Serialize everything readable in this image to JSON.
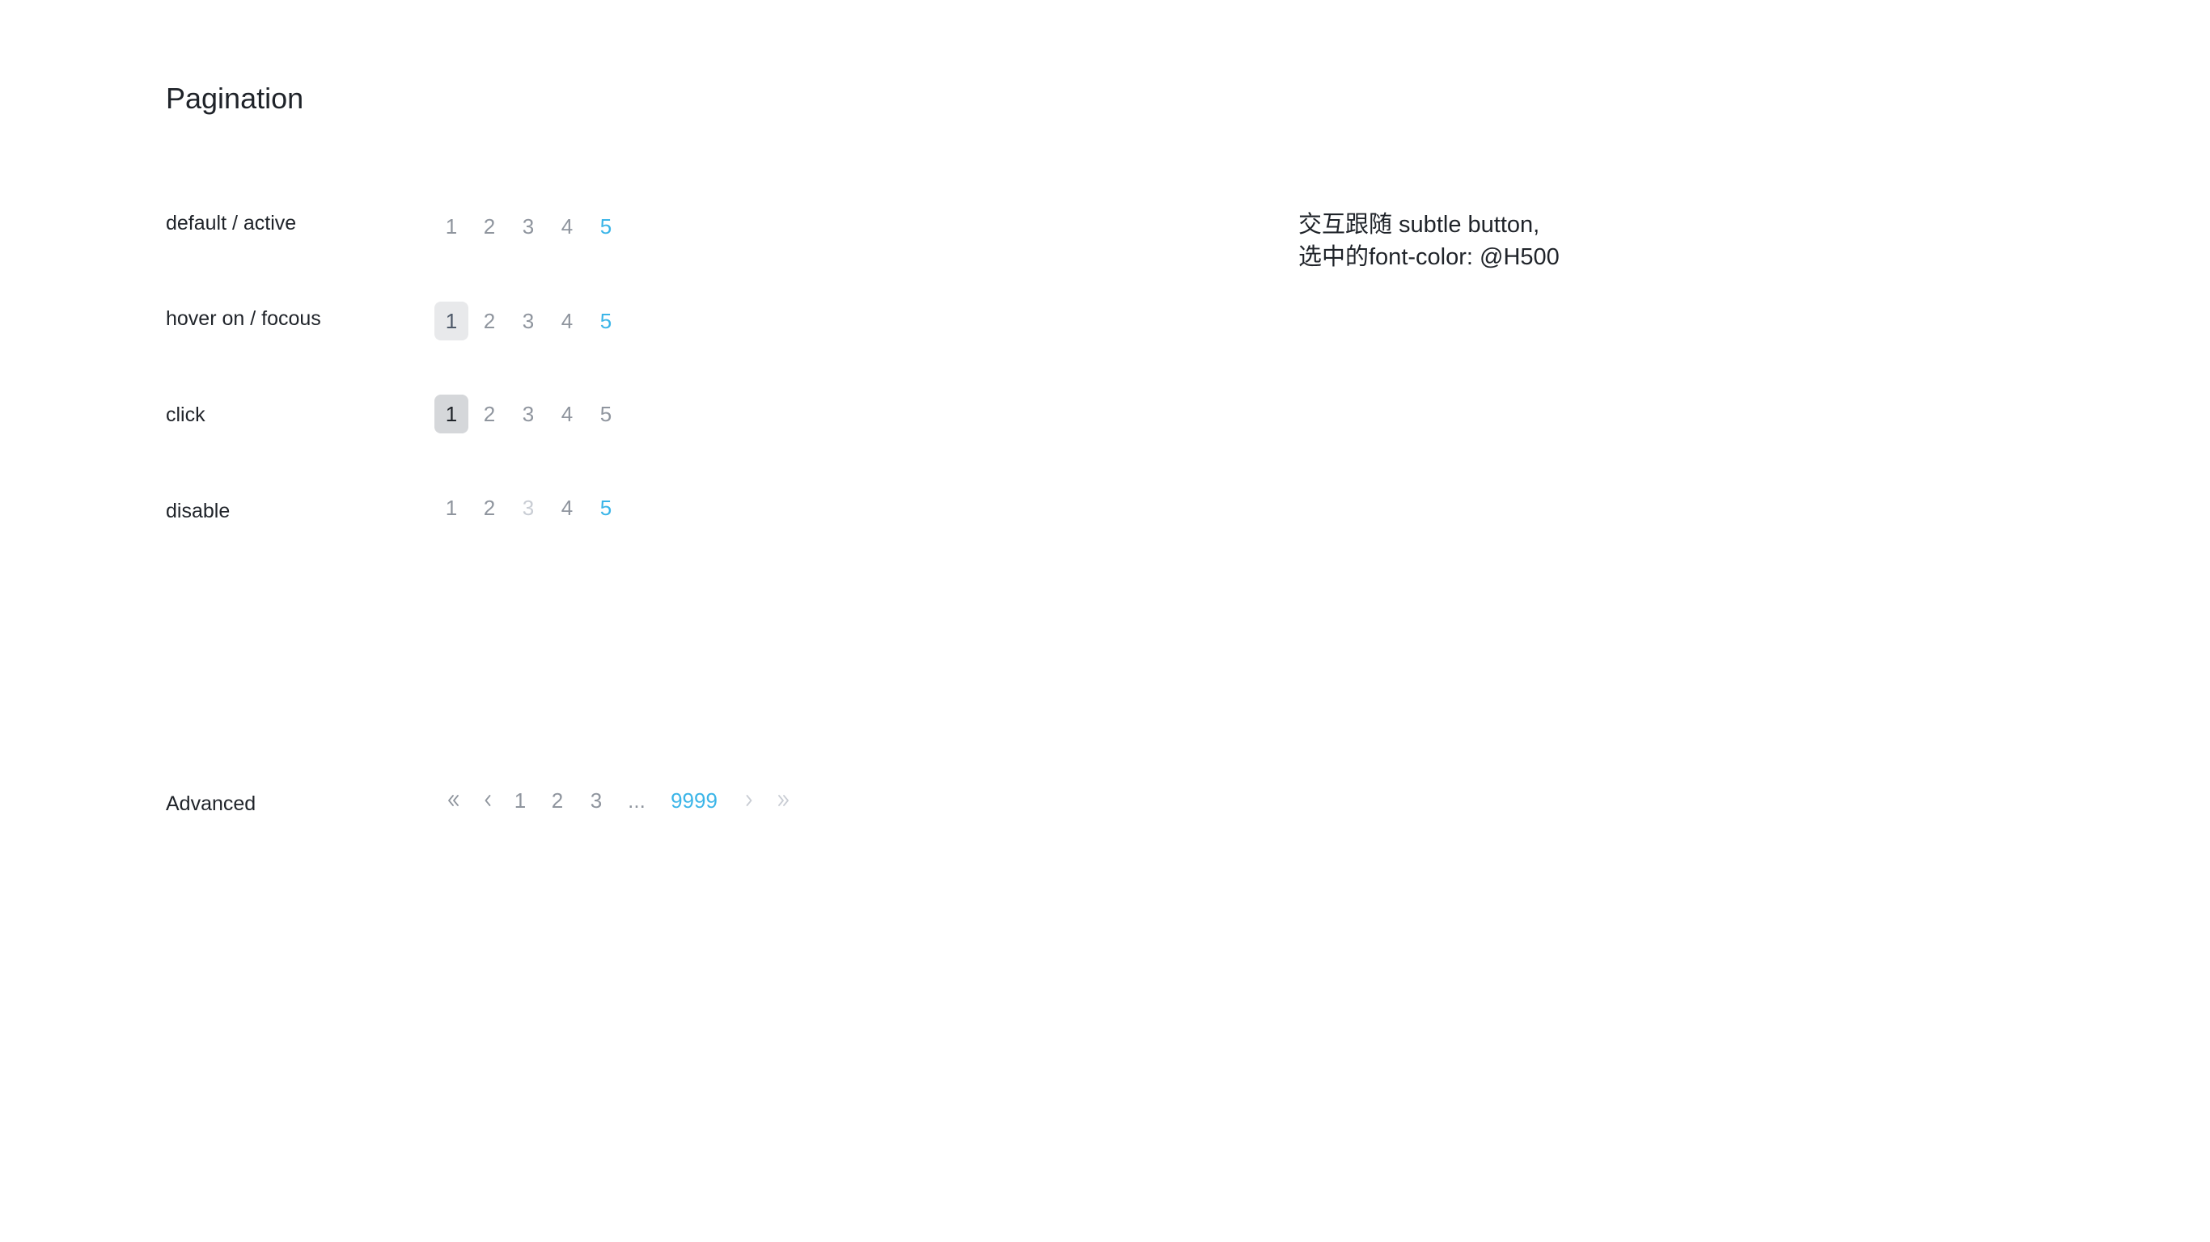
{
  "title": "Pagination",
  "rows": [
    {
      "label": "default / active",
      "pages": [
        "1",
        "2",
        "3",
        "4",
        "5"
      ]
    },
    {
      "label": "hover on / focous",
      "pages": [
        "1",
        "2",
        "3",
        "4",
        "5"
      ]
    },
    {
      "label": "click",
      "pages": [
        "1",
        "2",
        "3",
        "4",
        "5"
      ]
    },
    {
      "label": "disable",
      "pages": [
        "1",
        "2",
        "3",
        "4",
        "5"
      ]
    }
  ],
  "advanced": {
    "label": "Advanced",
    "pages": [
      "1",
      "2",
      "3"
    ],
    "ellipsis": "...",
    "last": "9999",
    "icons": [
      "double-chevron-left-icon",
      "chevron-left-icon",
      "chevron-right-icon",
      "double-chevron-right-icon"
    ]
  },
  "note": {
    "line1": "交互跟随 subtle button,",
    "line2": "选中的font-color: @H500"
  },
  "colors": {
    "active": "#3bb5e8",
    "default": "#8f959e",
    "disabled": "#c9cdd4",
    "hover_bg": "#e8e9eb",
    "pressed_bg": "#d5d7da"
  }
}
